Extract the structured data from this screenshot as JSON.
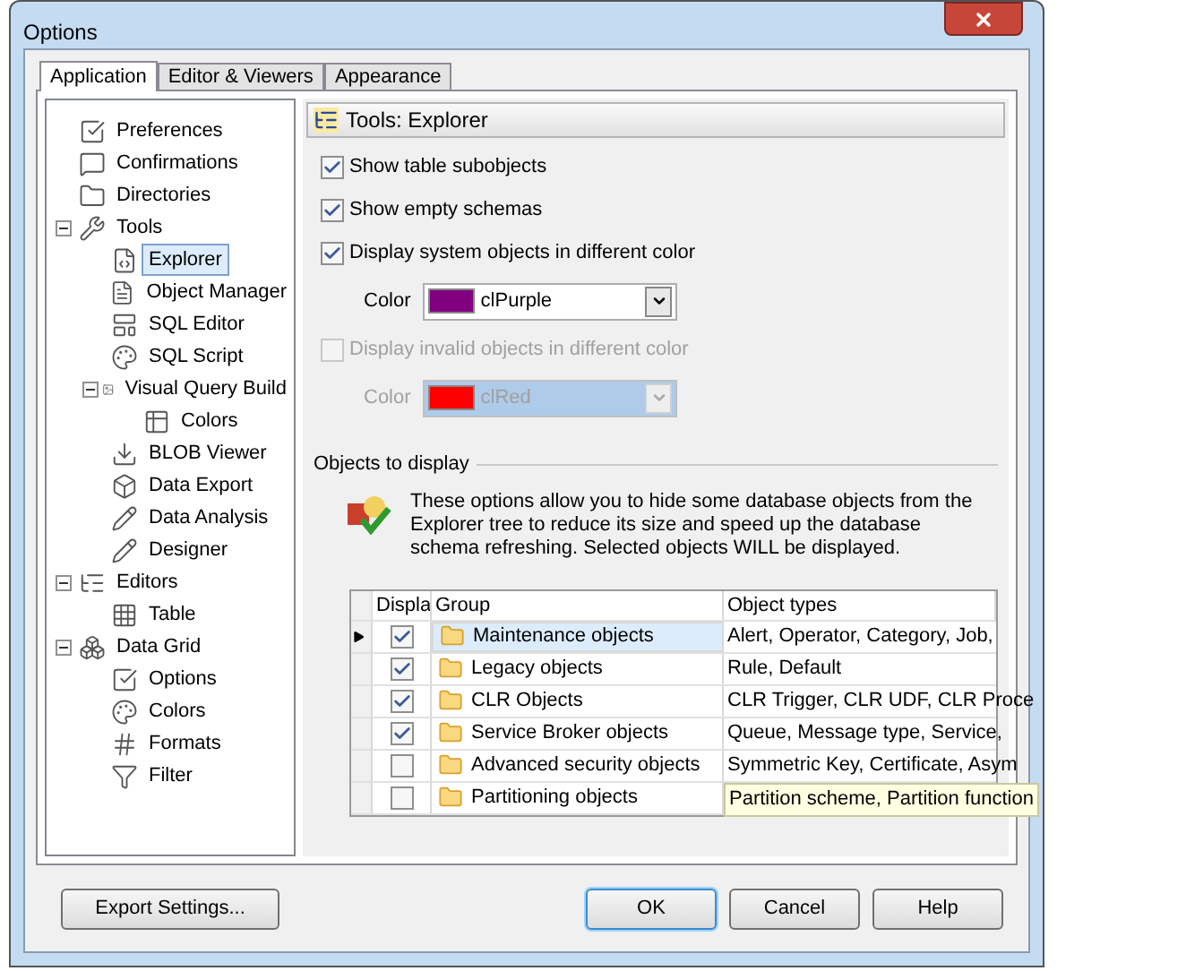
{
  "window": {
    "title": "Options"
  },
  "tabs": [
    {
      "label": "Application",
      "selected": true
    },
    {
      "label": "Editor & Viewers",
      "selected": false
    },
    {
      "label": "Appearance",
      "selected": false
    }
  ],
  "tree": [
    {
      "label": "Preferences",
      "selected": false
    },
    {
      "label": "Confirmations",
      "selected": false
    },
    {
      "label": "Directories",
      "selected": false
    },
    {
      "label": "Tools",
      "selected": false,
      "expanded": true,
      "children": [
        {
          "label": "Explorer",
          "selected": true
        },
        {
          "label": "Object Manager",
          "selected": false
        },
        {
          "label": "SQL Editor",
          "selected": false
        },
        {
          "label": "SQL Script",
          "selected": false
        },
        {
          "label": "Visual Query Build",
          "selected": false,
          "expanded": true,
          "children": [
            {
              "label": "Colors",
              "selected": false
            }
          ]
        },
        {
          "label": "BLOB Viewer",
          "selected": false
        },
        {
          "label": "Data Export",
          "selected": false
        },
        {
          "label": "Data Analysis",
          "selected": false
        },
        {
          "label": "Designer",
          "selected": false
        }
      ]
    },
    {
      "label": "Editors",
      "selected": false,
      "expanded": true,
      "children": [
        {
          "label": "Table",
          "selected": false
        }
      ]
    },
    {
      "label": "Data Grid",
      "selected": false,
      "expanded": true,
      "children": [
        {
          "label": "Options",
          "selected": false
        },
        {
          "label": "Colors",
          "selected": false
        },
        {
          "label": "Formats",
          "selected": false
        },
        {
          "label": "Filter",
          "selected": false
        }
      ]
    }
  ],
  "panel": {
    "header": "Tools: Explorer",
    "options": [
      {
        "kind": "checkbox",
        "label": "Show table subobjects",
        "checked": true,
        "disabled": false
      },
      {
        "kind": "checkbox",
        "label": "Show empty schemas",
        "checked": true,
        "disabled": false
      },
      {
        "kind": "checkbox",
        "label": "Display system objects in different color",
        "checked": true,
        "disabled": false
      },
      {
        "kind": "color",
        "label": "Color",
        "value": "clPurple",
        "color": "#800080",
        "disabled": false
      },
      {
        "kind": "checkbox",
        "label": "Display invalid objects in different color",
        "checked": false,
        "disabled": true
      },
      {
        "kind": "color",
        "label": "Color",
        "value": "clRed",
        "color": "#ff0000",
        "disabled": true
      }
    ]
  },
  "objects": {
    "title": "Objects to display",
    "description": "These options allow you to hide some database objects from the Explorer tree to reduce its size and speed up the database schema refreshing. Selected objects WILL be displayed.",
    "columns": [
      "Displa",
      "Group",
      "Object types"
    ],
    "rows": [
      {
        "display": true,
        "group": "Maintenance objects",
        "types": "Alert, Operator, Category, Job,",
        "selected": true,
        "tooltip": false
      },
      {
        "display": true,
        "group": "Legacy objects",
        "types": "Rule, Default",
        "selected": false,
        "tooltip": false
      },
      {
        "display": true,
        "group": "CLR Objects",
        "types": "CLR Trigger, CLR UDF, CLR Proce",
        "selected": false,
        "tooltip": false
      },
      {
        "display": true,
        "group": "Service Broker objects",
        "types": "Queue, Message type, Service,",
        "selected": false,
        "tooltip": false
      },
      {
        "display": false,
        "group": "Advanced security objects",
        "types": "Symmetric Key, Certificate, Asym",
        "selected": false,
        "tooltip": false
      },
      {
        "display": false,
        "group": "Partitioning objects",
        "types": "Partition scheme, Partition function",
        "selected": false,
        "tooltip": true
      }
    ]
  },
  "buttons": [
    {
      "label": "Export Settings...",
      "default": false
    },
    {
      "label": "OK",
      "default": true
    },
    {
      "label": "Cancel",
      "default": false
    },
    {
      "label": "Help",
      "default": false
    }
  ]
}
